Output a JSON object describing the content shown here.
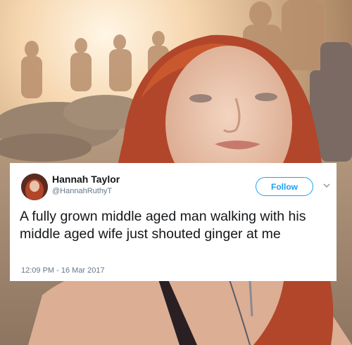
{
  "tweet": {
    "display_name": "Hannah Taylor",
    "handle": "@HannahRuthyT",
    "follow_label": "Follow",
    "text": "A fully grown middle aged man walking with his middle aged wife just shouted ginger at me",
    "timestamp": "12:09 PM - 16 Mar 2017"
  },
  "icons": {
    "chevron": "chevron-down-icon",
    "avatar": "avatar"
  },
  "colors": {
    "accent": "#1da1f2",
    "name": "#14171a",
    "meta": "#657786",
    "card_bg": "#ffffff"
  }
}
